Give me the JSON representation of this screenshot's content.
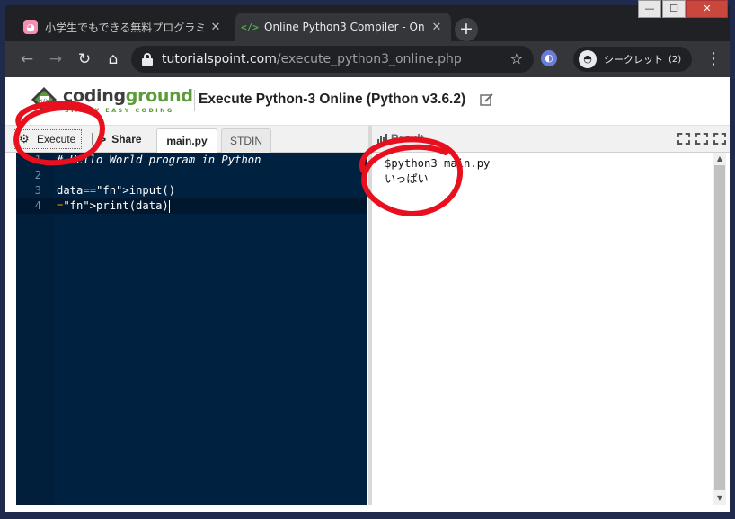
{
  "browser": {
    "tabs": [
      {
        "title": "小学生でもできる無料プログラミ",
        "favicon": "pig-icon",
        "close": "✕"
      },
      {
        "title": "Online Python3 Compiler - On",
        "favicon": "code-icon",
        "close": "✕"
      }
    ],
    "new_tab": "+",
    "url_host": "tutorialspoint.com",
    "url_path": "/execute_python3_online.php",
    "incognito_label": "シークレット",
    "incognito_count": "(2)"
  },
  "site": {
    "brand_prefix": "coding",
    "brand_suffix": "ground",
    "tagline": "SIMPLY EASY CODING",
    "page_title": "Execute Python-3 Online (Python v3.6.2)"
  },
  "toolbar": {
    "execute_label": "Execute",
    "share_label": "Share",
    "file_tab": "main.py",
    "stdin_tab": "STDIN",
    "result_label": "Result"
  },
  "editor": {
    "lines": [
      {
        "num": "1",
        "text": "# Hello World program in Python"
      },
      {
        "num": "2",
        "text": ""
      },
      {
        "num": "3",
        "text": "data=input()"
      },
      {
        "num": "4",
        "text": "print(data)"
      }
    ]
  },
  "output": {
    "lines": [
      "$python3 main.py",
      "いっぱい"
    ]
  },
  "colors": {
    "annotation_red": "#e8101e",
    "editor_bg": "#002240",
    "brand_green": "#5b9b3a"
  }
}
